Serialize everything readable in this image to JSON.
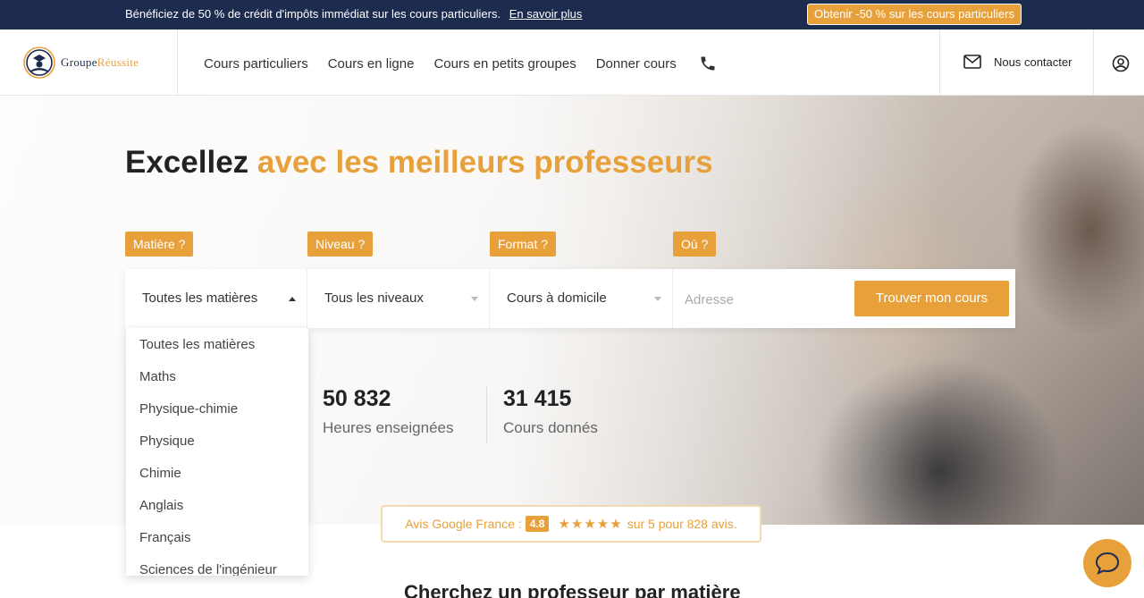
{
  "promo": {
    "message": "Bénéficiez de 50 % de crédit d'impôts immédiat sur les cours particuliers.",
    "link": "En savoir plus",
    "cta": "Obtenir -50 % sur les cours particuliers"
  },
  "header": {
    "brand_prefix": "Groupe",
    "brand_suffix": "Réussite",
    "nav": [
      "Cours particuliers",
      "Cours en ligne",
      "Cours en petits groupes",
      "Donner cours"
    ],
    "contact": "Nous contacter"
  },
  "hero": {
    "headline_plain": "Excellez",
    "headline_accent": "avec les meilleurs professeurs",
    "tags": [
      "Matière ?",
      "Niveau ?",
      "Format ?",
      "Où ?"
    ],
    "selects": [
      "Toutes les matières",
      "Tous les niveaux",
      "Cours à domicile"
    ],
    "address_placeholder": "Adresse",
    "search_button": "Trouver mon cours",
    "stats": [
      {
        "value": "50 832",
        "label": "Heures enseignées"
      },
      {
        "value": "31 415",
        "label": "Cours donnés"
      }
    ]
  },
  "dropdown": {
    "options": [
      "Toutes les matières",
      "Maths",
      "Physique-chimie",
      "Physique",
      "Chimie",
      "Anglais",
      "Français",
      "Sciences de l'ingénieur"
    ]
  },
  "reviews": {
    "prefix": "Avis Google France :",
    "score": "4.8",
    "stars": "★★★★★",
    "suffix": "sur 5 pour 828 avis."
  },
  "section": {
    "title": "Cherchez un professeur par matière"
  },
  "colors": {
    "accent": "#e8a13a",
    "navy": "#1d2b4f"
  }
}
